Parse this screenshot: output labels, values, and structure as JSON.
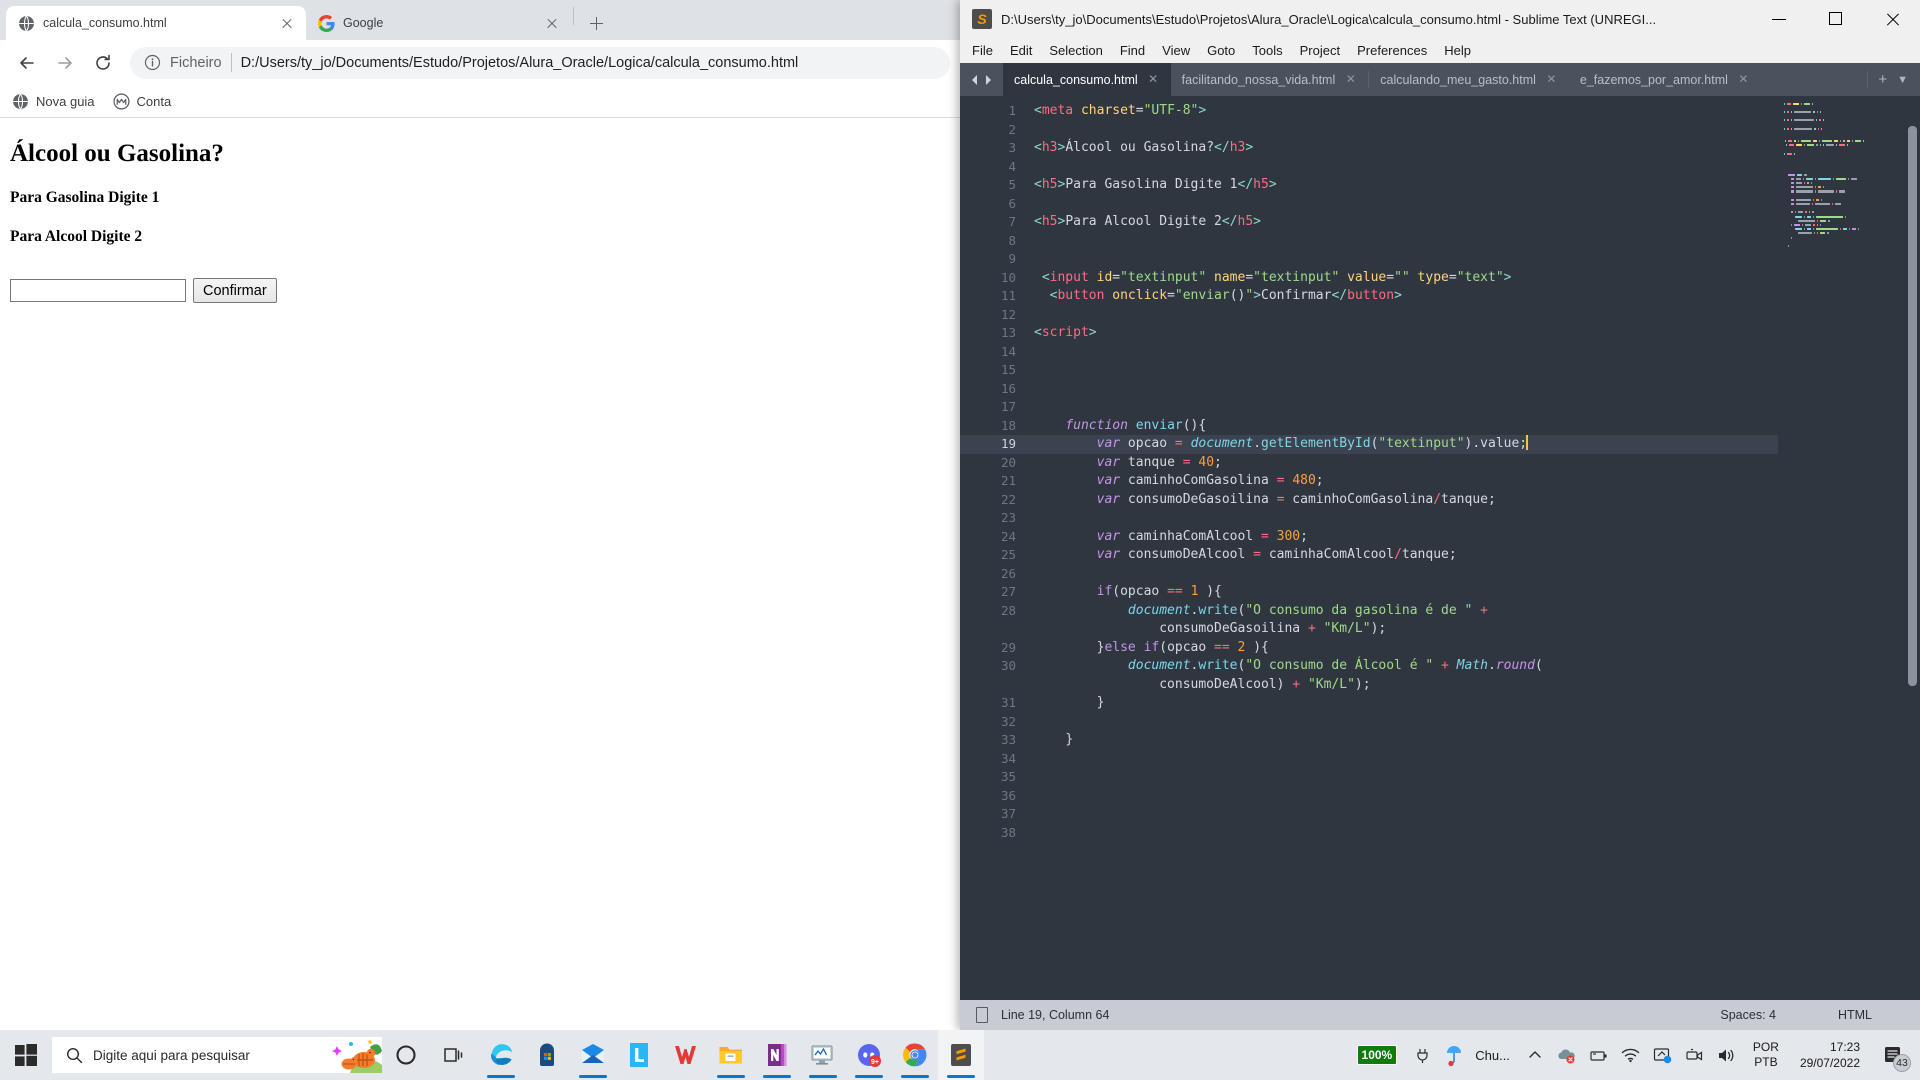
{
  "browser": {
    "tabs": [
      {
        "title": "calcula_consumo.html",
        "favicon": "globe-icon",
        "active": true
      },
      {
        "title": "Google",
        "favicon": "google-icon",
        "active": false
      }
    ],
    "new_tab_label": "+",
    "omnibox": {
      "scheme_label": "Ficheiro",
      "url": "D:/Users/ty_jo/Documents/Estudo/Projetos/Alura_Oracle/Logica/calcula_consumo.html"
    },
    "bookmarks": [
      {
        "label": "Nova guia",
        "icon": "globe-icon"
      },
      {
        "label": "Conta",
        "icon": "monogram-icon"
      }
    ],
    "page": {
      "heading": "Álcool ou Gasolina?",
      "line1": "Para Gasolina Digite 1",
      "line2": "Para Alcool Digite 2",
      "input_value": "",
      "input_placeholder": "",
      "button_label": "Confirmar"
    }
  },
  "sublime": {
    "window_title": "D:\\Users\\ty_jo\\Documents\\Estudo\\Projetos\\Alura_Oracle\\Logica\\calcula_consumo.html - Sublime Text (UNREGI...",
    "menu": [
      "File",
      "Edit",
      "Selection",
      "Find",
      "View",
      "Goto",
      "Tools",
      "Project",
      "Preferences",
      "Help"
    ],
    "tabs": [
      {
        "label": "calcula_consumo.html",
        "active": true
      },
      {
        "label": "facilitando_nossa_vida.html",
        "active": false
      },
      {
        "label": "calculando_meu_gasto.html",
        "active": false
      },
      {
        "label": "e_fazemos_por_amor.html",
        "active": false
      }
    ],
    "tabbar_add": "+",
    "tabbar_dropdown": "▼",
    "status": {
      "position": "Line 19, Column 64",
      "indent": "Spaces: 4",
      "syntax": "HTML"
    },
    "current_line": 19,
    "total_lines_visible": 38,
    "code_lines": [
      {
        "n": 1,
        "tokens": [
          [
            "t-brk",
            "<"
          ],
          [
            "t-tag",
            "meta"
          ],
          [
            "t-plain",
            " "
          ],
          [
            "t-attr",
            "charset"
          ],
          [
            "t-plain",
            "="
          ],
          [
            "t-str",
            "\"UTF-8\""
          ],
          [
            "t-brk",
            ">"
          ]
        ]
      },
      {
        "n": 2,
        "tokens": []
      },
      {
        "n": 3,
        "tokens": [
          [
            "t-brk",
            "<"
          ],
          [
            "t-tag",
            "h3"
          ],
          [
            "t-brk",
            ">"
          ],
          [
            "t-plain",
            "Álcool ou Gasolina?"
          ],
          [
            "t-brk",
            "</"
          ],
          [
            "t-tag",
            "h3"
          ],
          [
            "t-brk",
            ">"
          ]
        ]
      },
      {
        "n": 4,
        "tokens": []
      },
      {
        "n": 5,
        "tokens": [
          [
            "t-brk",
            "<"
          ],
          [
            "t-tag",
            "h5"
          ],
          [
            "t-brk",
            ">"
          ],
          [
            "t-plain",
            "Para Gasolina Digite 1"
          ],
          [
            "t-brk",
            "</"
          ],
          [
            "t-tag",
            "h5"
          ],
          [
            "t-brk",
            ">"
          ]
        ]
      },
      {
        "n": 6,
        "tokens": []
      },
      {
        "n": 7,
        "tokens": [
          [
            "t-brk",
            "<"
          ],
          [
            "t-tag",
            "h5"
          ],
          [
            "t-brk",
            ">"
          ],
          [
            "t-plain",
            "Para Alcool Digite 2"
          ],
          [
            "t-brk",
            "</"
          ],
          [
            "t-tag",
            "h5"
          ],
          [
            "t-brk",
            ">"
          ]
        ]
      },
      {
        "n": 8,
        "tokens": []
      },
      {
        "n": 9,
        "tokens": []
      },
      {
        "n": 10,
        "tokens": [
          [
            "t-plain",
            " "
          ],
          [
            "t-brk",
            "<"
          ],
          [
            "t-tag",
            "input"
          ],
          [
            "t-plain",
            " "
          ],
          [
            "t-attr",
            "id"
          ],
          [
            "t-plain",
            "="
          ],
          [
            "t-str",
            "\"textinput\""
          ],
          [
            "t-plain",
            " "
          ],
          [
            "t-attr",
            "name"
          ],
          [
            "t-plain",
            "="
          ],
          [
            "t-str",
            "\"textinput\""
          ],
          [
            "t-plain",
            " "
          ],
          [
            "t-attr",
            "value"
          ],
          [
            "t-plain",
            "="
          ],
          [
            "t-str",
            "\"\""
          ],
          [
            "t-plain",
            " "
          ],
          [
            "t-attr",
            "type"
          ],
          [
            "t-plain",
            "="
          ],
          [
            "t-str",
            "\"text\""
          ],
          [
            "t-brk",
            ">"
          ]
        ]
      },
      {
        "n": 11,
        "tokens": [
          [
            "t-plain",
            "  "
          ],
          [
            "t-brk",
            "<"
          ],
          [
            "t-tag",
            "button"
          ],
          [
            "t-plain",
            " "
          ],
          [
            "t-attr",
            "onclick"
          ],
          [
            "t-plain",
            "="
          ],
          [
            "t-str",
            "\"enviar"
          ],
          [
            "t-punc",
            "()"
          ],
          [
            "t-str",
            "\""
          ],
          [
            "t-brk",
            ">"
          ],
          [
            "t-plain",
            "Confirmar"
          ],
          [
            "t-brk",
            "</"
          ],
          [
            "t-tag",
            "button"
          ],
          [
            "t-brk",
            ">"
          ]
        ]
      },
      {
        "n": 12,
        "tokens": []
      },
      {
        "n": 13,
        "tokens": [
          [
            "t-brk",
            "<"
          ],
          [
            "t-tag",
            "script"
          ],
          [
            "t-brk",
            ">"
          ]
        ]
      },
      {
        "n": 14,
        "tokens": []
      },
      {
        "n": 15,
        "tokens": []
      },
      {
        "n": 16,
        "tokens": []
      },
      {
        "n": 17,
        "tokens": []
      },
      {
        "n": 18,
        "tokens": [
          [
            "t-plain",
            "    "
          ],
          [
            "t-kw",
            "function"
          ],
          [
            "t-plain",
            " "
          ],
          [
            "t-fn",
            "enviar"
          ],
          [
            "t-punc",
            "(){"
          ]
        ]
      },
      {
        "n": 19,
        "tokens": [
          [
            "t-plain",
            "        "
          ],
          [
            "t-kw",
            "var"
          ],
          [
            "t-plain",
            " opcao "
          ],
          [
            "t-op",
            "="
          ],
          [
            "t-plain",
            " "
          ],
          [
            "t-obj",
            "document"
          ],
          [
            "t-punc",
            "."
          ],
          [
            "t-fn",
            "getElementById"
          ],
          [
            "t-punc",
            "("
          ],
          [
            "t-str",
            "\"textinput\""
          ],
          [
            "t-punc",
            ")"
          ],
          [
            "t-plain",
            ".value;"
          ]
        ],
        "caret": true
      },
      {
        "n": 20,
        "tokens": [
          [
            "t-plain",
            "        "
          ],
          [
            "t-kw",
            "var"
          ],
          [
            "t-plain",
            " tanque "
          ],
          [
            "t-op",
            "="
          ],
          [
            "t-plain",
            " "
          ],
          [
            "t-num",
            "40"
          ],
          [
            "t-plain",
            ";"
          ]
        ]
      },
      {
        "n": 21,
        "tokens": [
          [
            "t-plain",
            "        "
          ],
          [
            "t-kw",
            "var"
          ],
          [
            "t-plain",
            " caminhoComGasolina "
          ],
          [
            "t-op",
            "="
          ],
          [
            "t-plain",
            " "
          ],
          [
            "t-num",
            "480"
          ],
          [
            "t-plain",
            ";"
          ]
        ]
      },
      {
        "n": 22,
        "tokens": [
          [
            "t-plain",
            "        "
          ],
          [
            "t-kw",
            "var"
          ],
          [
            "t-plain",
            " consumoDeGasoilina "
          ],
          [
            "t-op",
            "="
          ],
          [
            "t-plain",
            " caminhoComGasolina"
          ],
          [
            "t-op",
            "/"
          ],
          [
            "t-plain",
            "tanque;"
          ]
        ]
      },
      {
        "n": 23,
        "tokens": []
      },
      {
        "n": 24,
        "tokens": [
          [
            "t-plain",
            "        "
          ],
          [
            "t-kw",
            "var"
          ],
          [
            "t-plain",
            " caminhaComAlcool "
          ],
          [
            "t-op",
            "="
          ],
          [
            "t-plain",
            " "
          ],
          [
            "t-num",
            "300"
          ],
          [
            "t-plain",
            ";"
          ]
        ]
      },
      {
        "n": 25,
        "tokens": [
          [
            "t-plain",
            "        "
          ],
          [
            "t-kw",
            "var"
          ],
          [
            "t-plain",
            " consumoDeAlcool "
          ],
          [
            "t-op",
            "="
          ],
          [
            "t-plain",
            " caminhaComAlcool"
          ],
          [
            "t-op",
            "/"
          ],
          [
            "t-plain",
            "tanque;"
          ]
        ]
      },
      {
        "n": 26,
        "tokens": []
      },
      {
        "n": 27,
        "tokens": [
          [
            "t-plain",
            "        "
          ],
          [
            "t-kw2",
            "if"
          ],
          [
            "t-punc",
            "("
          ],
          [
            "t-plain",
            "opcao "
          ],
          [
            "t-op",
            "=="
          ],
          [
            "t-plain",
            " "
          ],
          [
            "t-num",
            "1"
          ],
          [
            "t-plain",
            " "
          ],
          [
            "t-punc",
            "){"
          ]
        ]
      },
      {
        "n": 28,
        "tokens": [
          [
            "t-plain",
            "            "
          ],
          [
            "t-obj",
            "document"
          ],
          [
            "t-punc",
            "."
          ],
          [
            "t-fn",
            "write"
          ],
          [
            "t-punc",
            "("
          ],
          [
            "t-str",
            "\"O consumo da gasolina é de \""
          ],
          [
            "t-plain",
            " "
          ],
          [
            "t-op",
            "+"
          ]
        ]
      },
      {
        "n": 0,
        "tokens": [
          [
            "t-plain",
            "                consumoDeGasoilina "
          ],
          [
            "t-op",
            "+"
          ],
          [
            "t-plain",
            " "
          ],
          [
            "t-str",
            "\"Km/L\""
          ],
          [
            "t-punc",
            ");"
          ]
        ]
      },
      {
        "n": 29,
        "tokens": [
          [
            "t-plain",
            "        "
          ],
          [
            "t-punc",
            "}"
          ],
          [
            "t-kw2",
            "else if"
          ],
          [
            "t-punc",
            "("
          ],
          [
            "t-plain",
            "opcao "
          ],
          [
            "t-op",
            "=="
          ],
          [
            "t-plain",
            " "
          ],
          [
            "t-num",
            "2"
          ],
          [
            "t-plain",
            " "
          ],
          [
            "t-punc",
            "){"
          ]
        ]
      },
      {
        "n": 30,
        "tokens": [
          [
            "t-plain",
            "            "
          ],
          [
            "t-obj",
            "document"
          ],
          [
            "t-punc",
            "."
          ],
          [
            "t-fn",
            "write"
          ],
          [
            "t-punc",
            "("
          ],
          [
            "t-str",
            "\"O consumo de Álcool é \""
          ],
          [
            "t-plain",
            " "
          ],
          [
            "t-op",
            "+"
          ],
          [
            "t-plain",
            " "
          ],
          [
            "t-obj",
            "Math"
          ],
          [
            "t-punc",
            "."
          ],
          [
            "t-var",
            "round"
          ],
          [
            "t-punc",
            "("
          ]
        ]
      },
      {
        "n": 0,
        "tokens": [
          [
            "t-plain",
            "                consumoDeAlcool"
          ],
          [
            "t-punc",
            ")"
          ],
          [
            "t-plain",
            " "
          ],
          [
            "t-op",
            "+"
          ],
          [
            "t-plain",
            " "
          ],
          [
            "t-str",
            "\"Km/L\""
          ],
          [
            "t-punc",
            ");"
          ]
        ]
      },
      {
        "n": 31,
        "tokens": [
          [
            "t-plain",
            "        "
          ],
          [
            "t-punc",
            "}"
          ]
        ]
      },
      {
        "n": 32,
        "tokens": []
      },
      {
        "n": 33,
        "tokens": [
          [
            "t-plain",
            "    "
          ],
          [
            "t-punc",
            "}"
          ]
        ]
      },
      {
        "n": 34,
        "tokens": []
      },
      {
        "n": 35,
        "tokens": []
      },
      {
        "n": 36,
        "tokens": []
      },
      {
        "n": 37,
        "tokens": []
      },
      {
        "n": 38,
        "tokens": []
      }
    ]
  },
  "taskbar": {
    "search_placeholder": "Digite aqui para pesquisar",
    "apps": [
      {
        "name": "edge",
        "running": true
      },
      {
        "name": "microsoft-store",
        "running": false
      },
      {
        "name": "mail",
        "running": true
      },
      {
        "name": "l-app",
        "running": false
      },
      {
        "name": "wps-office",
        "running": false
      },
      {
        "name": "file-explorer",
        "running": true
      },
      {
        "name": "onenote",
        "running": true
      },
      {
        "name": "monitor-app",
        "running": true
      },
      {
        "name": "discord",
        "running": true,
        "badge": "9+"
      },
      {
        "name": "chrome",
        "running": true
      },
      {
        "name": "sublime-text",
        "running": true,
        "active": true
      }
    ],
    "battery_label": "100%",
    "weather_label": "Chu...",
    "language": {
      "line1": "POR",
      "line2": "PTB"
    },
    "clock": {
      "time": "17:23",
      "date": "29/07/2022"
    },
    "notification_count": "43"
  },
  "colors": {
    "chrome_tabstrip": "#dee1e6",
    "sublime_bg": "#2f3640",
    "sublime_tabbar": "#4a525e",
    "status_bar": "#c8ccd2",
    "taskbar": "#e4e7ec",
    "accent_blue": "#0078d7",
    "battery_green": "#107c10",
    "caret": "#f5c542"
  }
}
